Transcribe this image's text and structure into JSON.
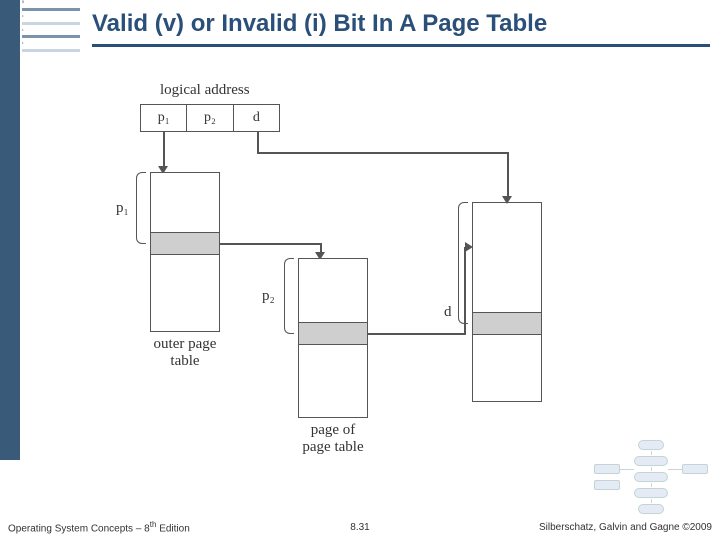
{
  "title": "Valid (v) or Invalid (i) Bit In A Page Table",
  "logical_address": {
    "label": "logical address",
    "cells": [
      "p₁",
      "p₂",
      "d"
    ]
  },
  "pointers": {
    "p1": "p₁",
    "p2": "p₂",
    "d": "d"
  },
  "labels": {
    "outer": "outer page\ntable",
    "pagetable": "page of\npage table"
  },
  "footer": {
    "left_book": "Operating System Concepts – 8",
    "left_sup": "th",
    "left_suffix": " Edition",
    "center": "8.31",
    "right_authors": "Silberschatz, Galvin and Gagne ",
    "right_copy": "©2009"
  }
}
